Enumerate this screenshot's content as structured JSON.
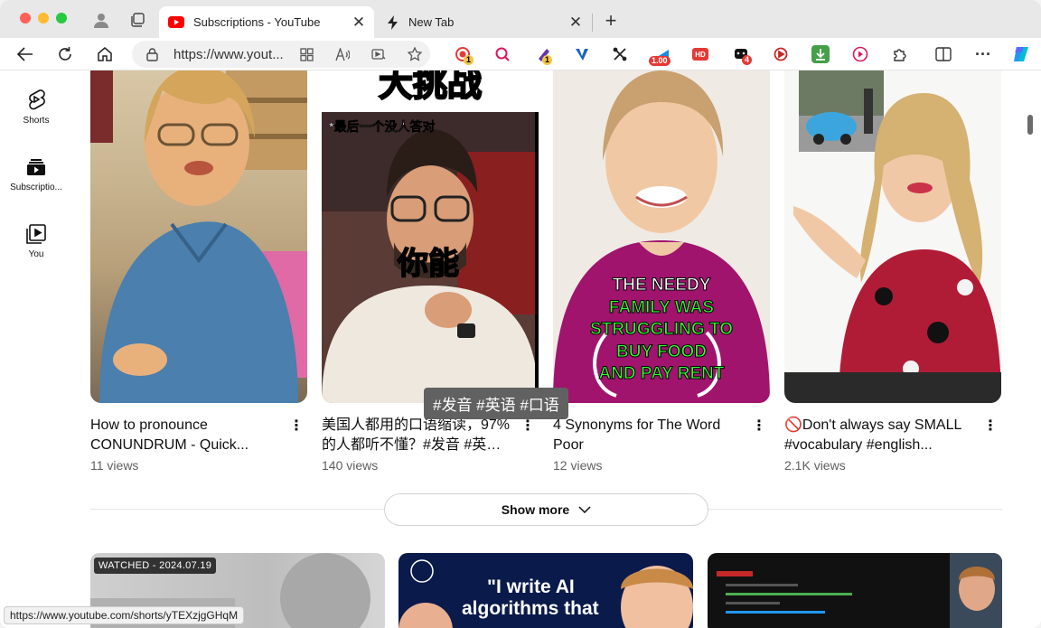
{
  "browser": {
    "tabs": [
      {
        "label": "Subscriptions - YouTube",
        "active": true,
        "icon": "youtube-icon"
      },
      {
        "label": "New Tab",
        "active": false,
        "icon": "lightning-icon"
      }
    ],
    "address_url": "https://www.yout...",
    "extensions": {
      "badge_1": "1",
      "badge_2": "1",
      "price_badge": "1.00",
      "hd_label": "HD",
      "badge_4": "4"
    },
    "status_url": "https://www.youtube.com/shorts/yTEXzjgGHqM"
  },
  "guide": {
    "items": [
      {
        "label": "Shorts",
        "icon": "shorts-icon"
      },
      {
        "label": "Subscriptio...",
        "icon": "subscriptions-icon"
      },
      {
        "label": "You",
        "icon": "you-library-icon"
      }
    ]
  },
  "shorts": [
    {
      "title": "How to pronounce CONUNDRUM - Quick...",
      "views": "11 views",
      "overlay": ""
    },
    {
      "title": "美国人都用的口语缩读，97%的人都听不懂？#发音 #英语 ...",
      "views": "140 views",
      "overlay_top": "大挑战",
      "overlay_sub": "*最后一个没人答对",
      "overlay_mid": "你能"
    },
    {
      "title": "4 Synonyms for The Word Poor",
      "views": "12 views",
      "overlay_lines": [
        "THE NEEDY",
        "FAMILY WAS",
        "STRUGGLING TO",
        "BUY FOOD",
        "AND PAY RENT"
      ]
    },
    {
      "title": "🚫Don't always say SMALL #vocabulary #english...",
      "views": "2.1K views",
      "overlay": ""
    }
  ],
  "tooltip": "#发音 #英语 #口语",
  "show_more": "Show more",
  "videos": [
    {
      "badge": "WATCHED - 2024.07.19"
    },
    {
      "overlay_line1": "\"I write AI",
      "overlay_line2": "algorithms that"
    },
    {
      "overlay": ""
    }
  ],
  "colors": {
    "youtube_red": "#ff0000",
    "needy_green": "#33ff33",
    "magenta_bg": "#a0146e"
  }
}
